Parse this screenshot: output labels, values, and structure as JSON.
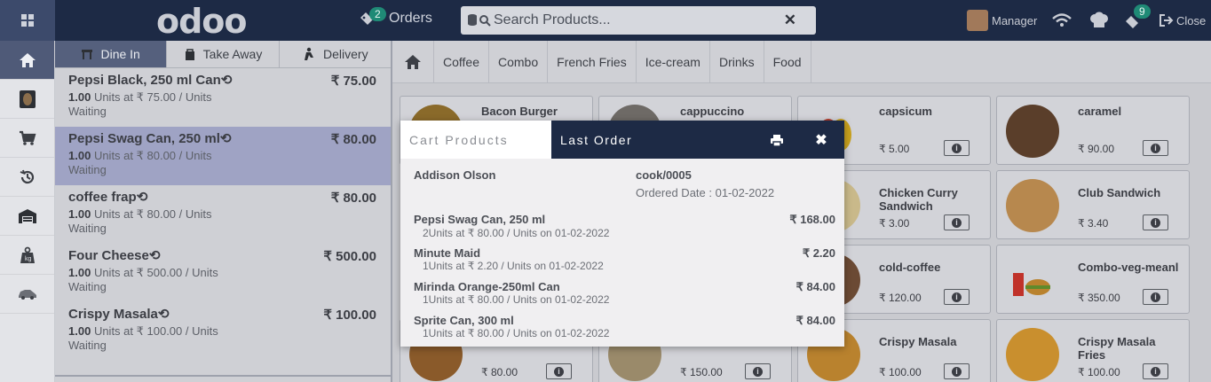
{
  "topbar": {
    "logo": "odoo",
    "orders_label": "Orders",
    "orders_count": "2",
    "search_placeholder": "Search Products...",
    "user": "Manager",
    "tickets_count": "9",
    "close_label": "Close"
  },
  "order_tabs": [
    "Dine In",
    "Take Away",
    "Delivery"
  ],
  "order_lines": [
    {
      "name": "Pepsi Black, 250 ml Can",
      "price": "₹ 75.00",
      "qty": "1.00",
      "detail": "Units at ₹ 75.00 / Units",
      "status": "Waiting"
    },
    {
      "name": "Pepsi Swag Can, 250 ml",
      "price": "₹ 80.00",
      "qty": "1.00",
      "detail": "Units at ₹ 80.00 / Units",
      "status": "Waiting"
    },
    {
      "name": "coffee frap",
      "price": "₹ 80.00",
      "qty": "1.00",
      "detail": "Units at ₹ 80.00 / Units",
      "status": "Waiting"
    },
    {
      "name": "Four Cheese",
      "price": "₹ 500.00",
      "qty": "1.00",
      "detail": "Units at ₹ 500.00 / Units",
      "status": "Waiting"
    },
    {
      "name": "Crispy Masala",
      "price": "₹ 100.00",
      "qty": "1.00",
      "detail": "Units at ₹ 100.00 / Units",
      "status": "Waiting"
    }
  ],
  "categories": [
    "Coffee",
    "Combo",
    "French Fries",
    "Ice-cream",
    "Drinks",
    "Food"
  ],
  "products": [
    {
      "name": "Bacon Burger",
      "price": ""
    },
    {
      "name": "cappuccino",
      "price": ""
    },
    {
      "name": "capsicum",
      "price": "₹ 5.00"
    },
    {
      "name": "caramel",
      "price": "₹ 90.00"
    },
    {
      "name": "Chicken Curry Sandwich",
      "price": "₹ 3.00"
    },
    {
      "name": "Club Sandwich",
      "price": "₹ 3.40"
    },
    {
      "name": "cold-coffee",
      "price": "₹ 120.00"
    },
    {
      "name": "Combo-veg-meanl",
      "price": "₹ 350.00"
    },
    {
      "name": "",
      "price": "₹ 80.00"
    },
    {
      "name": "",
      "price": "₹ 150.00"
    },
    {
      "name": "Crispy Masala",
      "price": "₹ 100.00"
    },
    {
      "name": "Crispy Masala Fries",
      "price": "₹ 100.00"
    }
  ],
  "modal": {
    "tab_cart": "Cart Products",
    "tab_last": "Last Order",
    "customer": "Addison Olson",
    "ref": "cook/0005",
    "ordered_date": "Ordered Date : 01-02-2022",
    "lines": [
      {
        "name": "Pepsi Swag Can, 250 ml",
        "amount": "₹ 168.00",
        "detail": "2Units at ₹ 80.00 / Units on 01-02-2022"
      },
      {
        "name": "Minute Maid",
        "amount": "₹ 2.20",
        "detail": "1Units at ₹ 2.20 / Units on 01-02-2022"
      },
      {
        "name": "Mirinda Orange-250ml Can",
        "amount": "₹ 84.00",
        "detail": "1Units at ₹ 80.00 / Units on 01-02-2022"
      },
      {
        "name": "Sprite Can, 300 ml",
        "amount": "₹ 84.00",
        "detail": "1Units at ₹ 80.00 / Units on 01-02-2022"
      }
    ]
  }
}
